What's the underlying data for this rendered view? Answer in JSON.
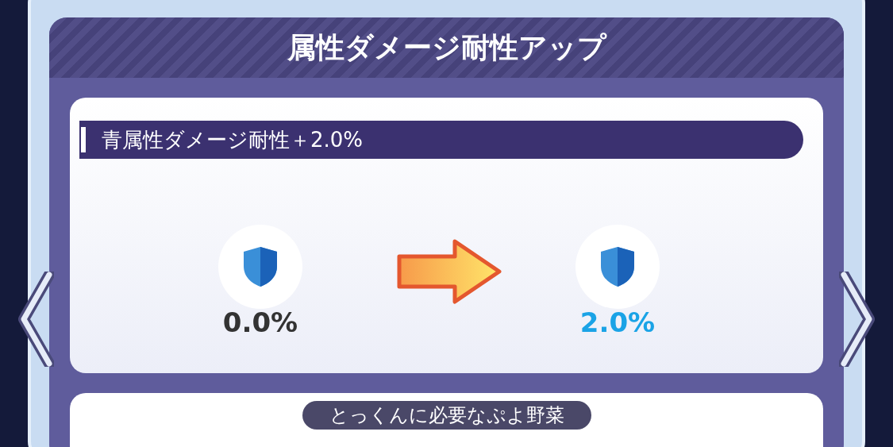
{
  "panel": {
    "title": "属性ダメージ耐性アップ"
  },
  "effect": {
    "label": "青属性ダメージ耐性＋2.0%",
    "before": "0.0%",
    "after": "2.0%"
  },
  "requirements": {
    "label": "とっくんに必要なぷよ野菜"
  }
}
